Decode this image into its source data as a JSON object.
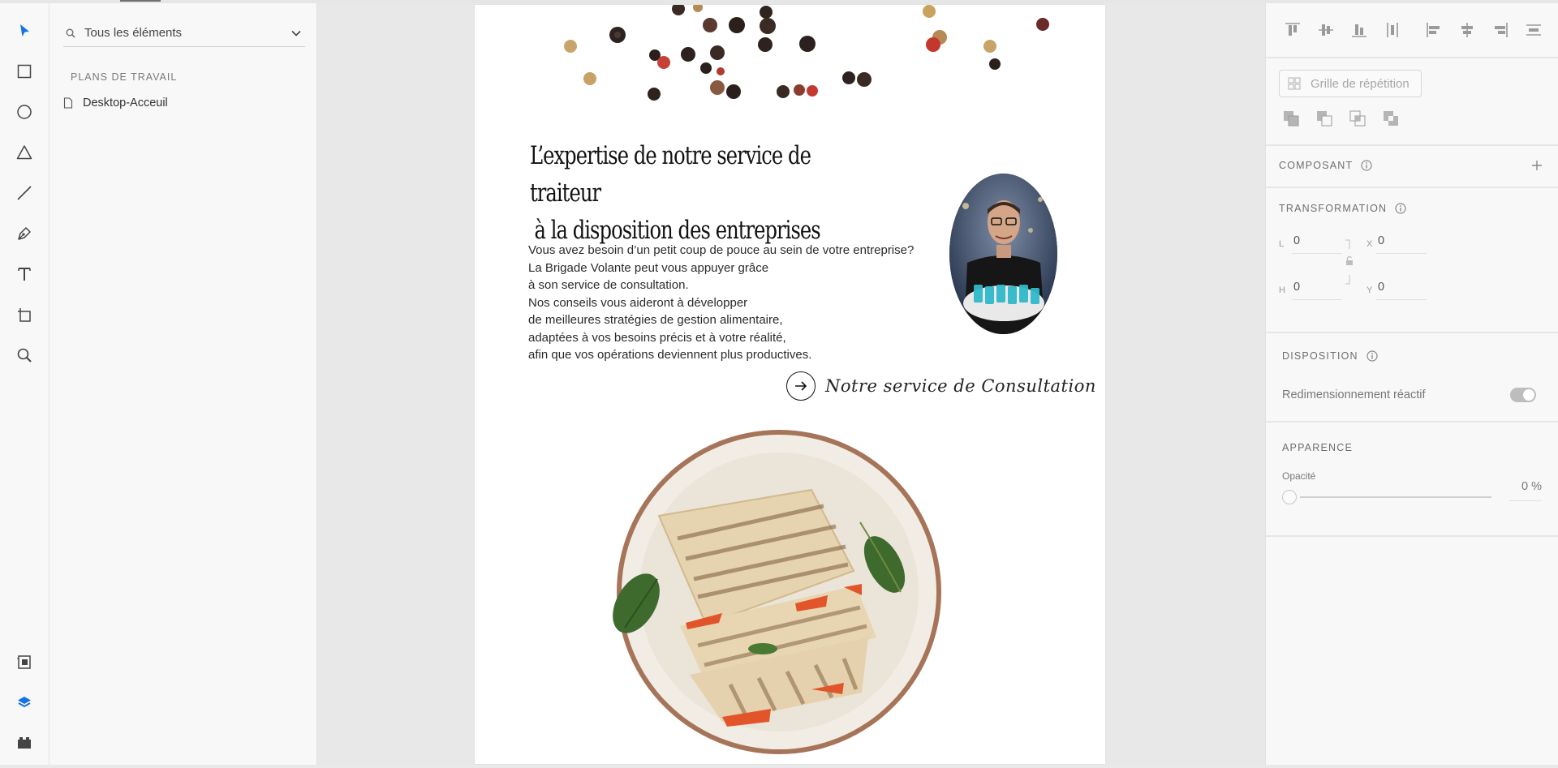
{
  "layers_panel": {
    "search_label": "Tous les éléments",
    "section_title": "PLANS DE TRAVAIL",
    "artboard_name": "Desktop-Acceuil"
  },
  "toolbar": {
    "tools": [
      "select-tool",
      "rectangle-tool",
      "ellipse-tool",
      "polygon-tool",
      "line-tool",
      "pen-tool",
      "text-tool",
      "artboard-tool",
      "zoom-tool"
    ],
    "bottom": [
      "assets-icon",
      "layers-icon",
      "plugins-icon"
    ],
    "active_tool": "select-tool",
    "active_color": "#1473e6"
  },
  "artboard": {
    "headline_line1": "L’expertise de notre service de traiteur",
    "headline_line2": "à la disposition des entreprises",
    "body_lines": [
      "Vous avez besoin d’un petit coup de pouce au sein de votre entreprise?",
      "La Brigade Volante peut vous appuyer grâce",
      "à son service de consultation.",
      "Nos conseils vous aideront à développer",
      "de meilleures stratégies de gestion alimentaire,",
      "adaptées à vos besoins précis et à votre réalité,",
      "afin que vos opérations deviennent plus productives."
    ],
    "cta_label": "Notre service de Consultation"
  },
  "properties": {
    "repeat_grid_label": "Grille de répétition",
    "component_title": "COMPOSANT",
    "transform_title": "TRANSFORMATION",
    "fields": {
      "l_label": "L",
      "l_value": "0",
      "h_label": "H",
      "h_value": "0",
      "x_label": "X",
      "x_value": "0",
      "y_label": "Y",
      "y_value": "0"
    },
    "layout_title": "DISPOSITION",
    "responsive_label": "Redimensionnement réactif",
    "responsive_on": true,
    "appearance_title": "APPARENCE",
    "opacity_label": "Opacité",
    "opacity_value": "0 %",
    "opacity_level": 0
  }
}
